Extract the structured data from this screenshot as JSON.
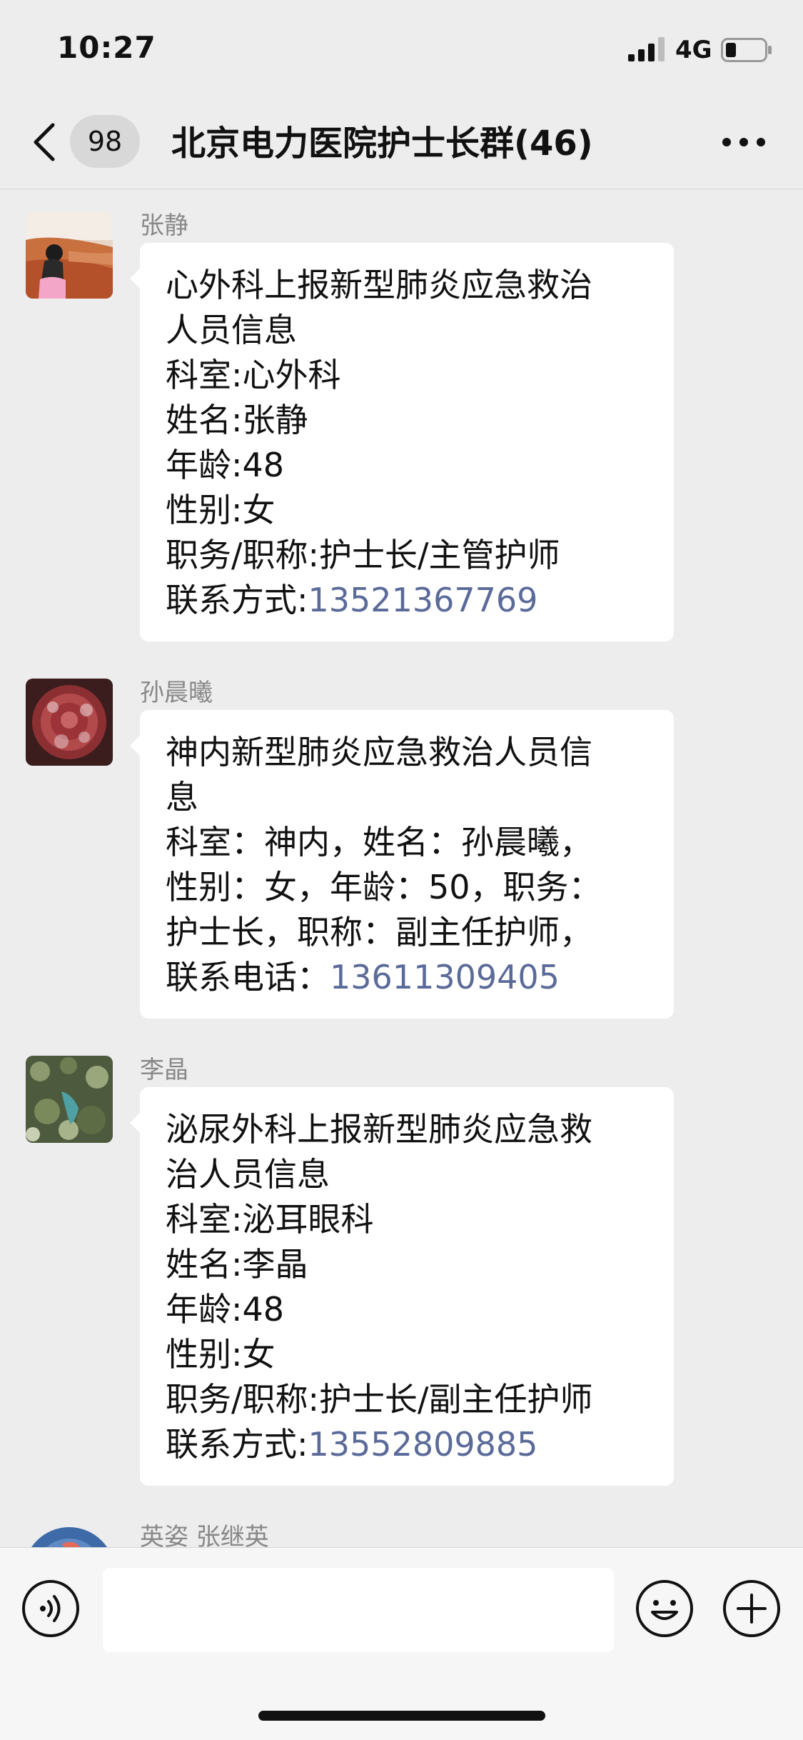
{
  "status_bar": {
    "time": "10:27",
    "network": "4G"
  },
  "nav": {
    "unread_count": "98",
    "title": "北京电力医院护士长群(46)"
  },
  "messages": [
    {
      "sender": "张静",
      "lines": [
        "心外科上报新型肺炎应急救治",
        "人员信息",
        "科室:心外科",
        "姓名:张静",
        "年龄:48",
        "性别:女",
        "职务/职称:护士长/主管护师"
      ],
      "phone_prefix": "联系方式:",
      "phone": "13521367769"
    },
    {
      "sender": "孙晨曦",
      "lines": [
        "神内新型肺炎应急救治人员信",
        "息",
        "科室：神内，姓名：孙晨曦，",
        "性别：女，年龄：50，职务：",
        "护士长，职称：副主任护师，"
      ],
      "phone_prefix": "联系电话：",
      "phone": "13611309405"
    },
    {
      "sender": "李晶",
      "lines": [
        "泌尿外科上报新型肺炎应急救",
        "治人员信息",
        "科室:泌耳眼科",
        "姓名:李晶",
        "年龄:48",
        "性别:女",
        "职务/职称:护士长/副主任护师"
      ],
      "phone_prefix": "联系方式:",
      "phone": "13552809885"
    },
    {
      "sender": "英姿 张继英"
    }
  ],
  "colors": {
    "background": "#ededed",
    "bubble": "#ffffff",
    "link": "#5b6b99",
    "sender": "#888888"
  }
}
